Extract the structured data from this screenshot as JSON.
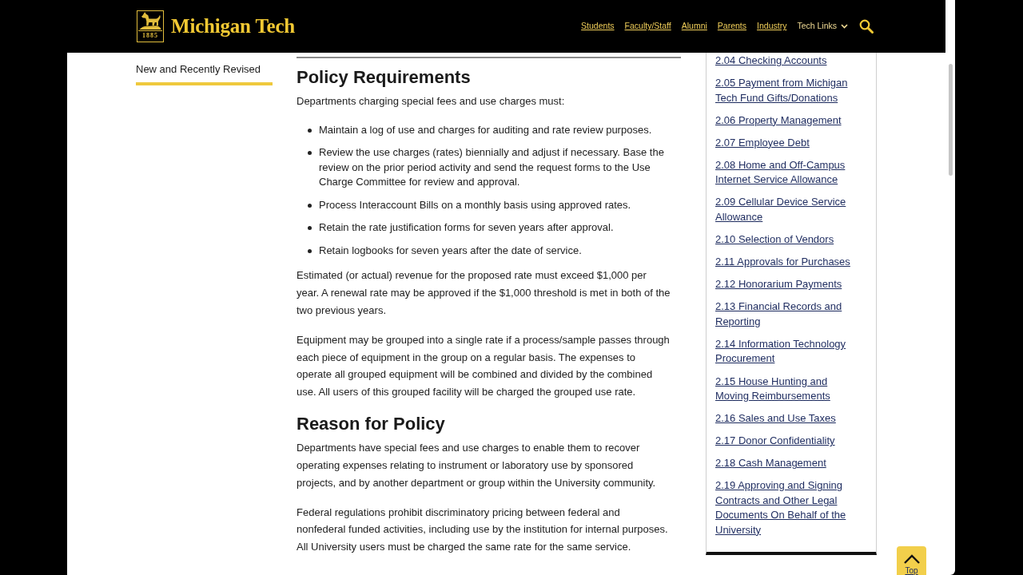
{
  "header": {
    "logo": {
      "year": "1885",
      "wordmark": "Michigan Tech"
    },
    "nav": [
      {
        "label": "Students",
        "kind": "link"
      },
      {
        "label": "Faculty/Staff",
        "kind": "link"
      },
      {
        "label": "Alumni",
        "kind": "link"
      },
      {
        "label": "Parents",
        "kind": "link"
      },
      {
        "label": "Industry",
        "kind": "link"
      },
      {
        "label": "Tech Links",
        "kind": "dropdown",
        "expanded": false
      }
    ]
  },
  "left_sidebar": {
    "heading": "New and Recently Revised"
  },
  "main": {
    "sections": [
      {
        "heading": "Policy Requirements",
        "blocks": [
          {
            "kind": "paragraph",
            "text": "Departments charging special fees and use charges must:"
          },
          {
            "kind": "bullets",
            "items": [
              "Maintain a log of use and charges for auditing and rate review purposes.",
              "Review the use charges (rates) biennially and adjust if necessary. Base the review on the prior period activity and send the request forms to the Use Charge Committee for review and approval.",
              "Process Interaccount Bills on a monthly basis using approved rates.",
              "Retain the rate justification forms for seven years after approval.",
              "Retain logbooks for seven years after the date of service."
            ]
          },
          {
            "kind": "paragraph",
            "text": "Estimated (or actual) revenue for the proposed rate must exceed $1,000 per year. A renewal rate may be approved if the $1,000 threshold is met in both of the two previous years."
          },
          {
            "kind": "paragraph",
            "text": "Equipment may be grouped into a single rate if a process/sample passes through each piece of equipment in the group on a regular basis. The expenses to operate all grouped equipment will be combined and divided by the combined use. All users of this grouped facility will be charged the grouped use rate."
          }
        ]
      },
      {
        "heading": "Reason for Policy",
        "blocks": [
          {
            "kind": "paragraph",
            "text": "Departments have special fees and use charges to enable them to recover operating expenses relating to instrument or laboratory use by sponsored projects, and by another department or group within the University community."
          },
          {
            "kind": "paragraph",
            "text": "Federal regulations prohibit discriminatory pricing between federal and nonfederal funded activities, including use by the institution for internal purposes. All University users must be charged the same rate for the same service."
          }
        ]
      }
    ]
  },
  "right_sidebar": {
    "links": [
      "2.04 Checking Accounts",
      "2.05 Payment from Michigan Tech Fund Gifts/Donations",
      "2.06 Property Management",
      "2.07 Employee Debt",
      "2.08 Home and Off-Campus Internet Service Allowance",
      "2.09 Cellular Device Service Allowance",
      "2.10 Selection of Vendors",
      "2.11 Approvals for Purchases",
      "2.12 Honorarium Payments",
      "2.13 Financial Records and Reporting",
      "2.14 Information Technology Procurement",
      "2.15 House Hunting and Moving Reimbursements",
      "2.16 Sales and Use Taxes",
      "2.17 Donor Confidentiality",
      "2.18 Cash Management",
      "2.19 Approving and Signing Contracts and Other Legal Documents On Behalf of the University"
    ]
  },
  "back_to_top": {
    "label": "Top"
  }
}
